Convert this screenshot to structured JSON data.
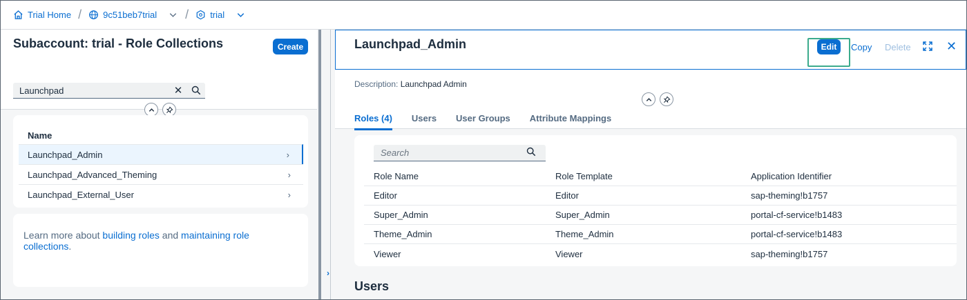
{
  "breadcrumb": {
    "items": [
      {
        "label": "Trial Home",
        "icon": "home-icon"
      },
      {
        "label": "9c51beb7trial",
        "icon": "globe-icon"
      },
      {
        "label": "trial",
        "icon": "subaccount-icon"
      }
    ]
  },
  "left": {
    "title": "Subaccount: trial - Role Collections",
    "create_label": "Create",
    "search_value": "Launchpad",
    "list_header": "Name",
    "items": [
      "Launchpad_Admin",
      "Launchpad_Advanced_Theming",
      "Launchpad_External_User"
    ],
    "learn": {
      "prefix": "Learn more about ",
      "link1": "building roles",
      "middle": " and ",
      "link2": "maintaining role collections",
      "suffix": "."
    }
  },
  "right": {
    "title": "Launchpad_Admin",
    "actions": {
      "edit": "Edit",
      "copy": "Copy",
      "delete": "Delete"
    },
    "description_label": "Description:",
    "description_value": "Launchpad Admin",
    "tabs": [
      "Roles (4)",
      "Users",
      "User Groups",
      "Attribute Mappings"
    ],
    "table_search_placeholder": "Search",
    "columns": [
      "Role Name",
      "Role Template",
      "Application Identifier"
    ],
    "rows": [
      [
        "Editor",
        "Editor",
        "sap-theming!b1757"
      ],
      [
        "Super_Admin",
        "Super_Admin",
        "portal-cf-service!b1483"
      ],
      [
        "Theme_Admin",
        "Theme_Admin",
        "portal-cf-service!b1483"
      ],
      [
        "Viewer",
        "Viewer",
        "sap-theming!b1757"
      ]
    ],
    "users_heading": "Users"
  },
  "colors": {
    "accent": "#0a6ed1",
    "highlight": "#3bab8c"
  }
}
